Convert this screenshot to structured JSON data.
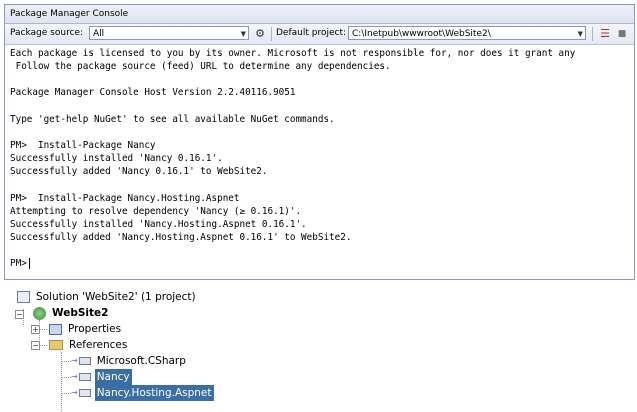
{
  "console": {
    "title": "Package Manager Console",
    "toolbar": {
      "package_source_label": "Package source:",
      "package_source_value": "All",
      "default_project_label": "Default project:",
      "default_project_value": "C:\\Inetpub\\wwwroot\\WebSite2\\"
    },
    "lines": [
      "Each package is licensed to you by its owner. Microsoft is not responsible for, nor does it grant any",
      " Follow the package source (feed) URL to determine any dependencies.",
      "",
      "Package Manager Console Host Version 2.2.40116.9051",
      "",
      "Type 'get-help NuGet' to see all available NuGet commands.",
      "",
      "PM>  Install-Package Nancy",
      "Successfully installed 'Nancy 0.16.1'.",
      "Successfully added 'Nancy 0.16.1' to WebSite2.",
      "",
      "PM>  Install-Package Nancy.Hosting.Aspnet",
      "Attempting to resolve dependency 'Nancy (≥ 0.16.1)'.",
      "Successfully installed 'Nancy.Hosting.Aspnet 0.16.1'.",
      "Successfully added 'Nancy.Hosting.Aspnet 0.16.1' to WebSite2.",
      "",
      "PM>"
    ]
  },
  "solution_explorer": {
    "solution": "Solution 'WebSite2' (1 project)",
    "project": "WebSite2",
    "properties": "Properties",
    "references": "References",
    "reference_items": [
      "Microsoft.CSharp",
      "Nancy",
      "Nancy.Hosting.Aspnet"
    ],
    "selected": [
      "Nancy",
      "Nancy.Hosting.Aspnet"
    ]
  },
  "icons": {
    "settings": "gear-icon",
    "clear": "clear-console-icon",
    "stop": "stop-icon",
    "dropdown": "chevron-down-icon"
  }
}
